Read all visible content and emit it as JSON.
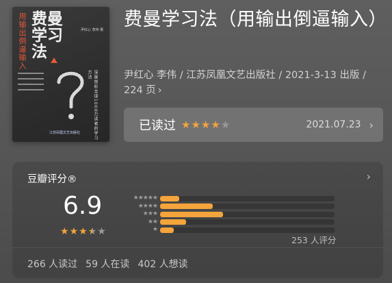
{
  "cover": {
    "vertical_text": "用输出倒逼输入",
    "big_title": "费曼学习法",
    "authors_small": "尹红心 李伟 著",
    "side_text": "深度剖析全球1000万读者的学习方法",
    "publisher": "江苏凤凰文艺出版社"
  },
  "book": {
    "title": "费曼学习法（用输出倒逼输入）",
    "meta": "尹红心 李伟 / 江苏凤凰文艺出版社 / 2021-3-13 出版 / 224 页"
  },
  "read_status": {
    "label": "已读过",
    "user_stars": 4,
    "date": "2021.07.23"
  },
  "rating": {
    "heading": "豆瓣评分®",
    "score": "6.9",
    "score_stars": 3.5,
    "distribution": [
      {
        "stars": 5,
        "fraction": 0.11
      },
      {
        "stars": 4,
        "fraction": 0.3
      },
      {
        "stars": 3,
        "fraction": 0.36
      },
      {
        "stars": 2,
        "fraction": 0.15
      },
      {
        "stars": 1,
        "fraction": 0.08
      }
    ],
    "votes": "253 人评分",
    "counts": [
      "266 人读过",
      "59 人在读",
      "402 人想读"
    ]
  },
  "colors": {
    "accent": "#f4a43b",
    "star_off": "#9a9a9a",
    "cover_red": "#e2583a"
  },
  "icons": {
    "chevron": "chevron-right-icon",
    "star": "star-icon"
  }
}
